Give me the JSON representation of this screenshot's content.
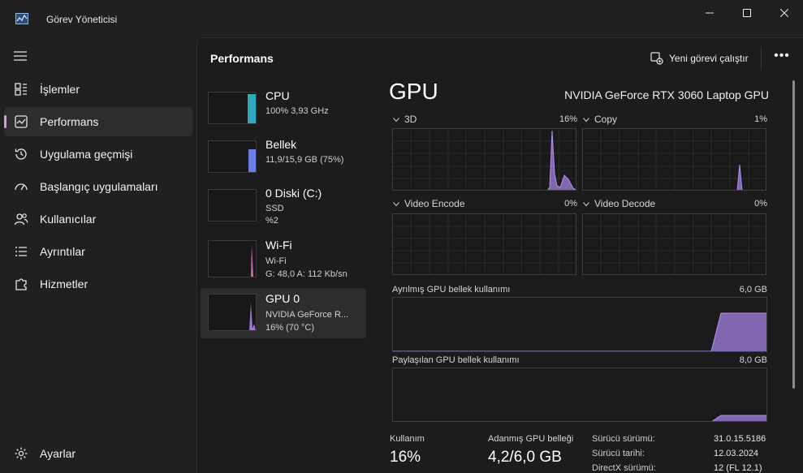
{
  "window": {
    "title": "Görev Yöneticisi"
  },
  "sidebar": {
    "items": [
      {
        "label": "İşlemler",
        "icon": "processes-grid-icon"
      },
      {
        "label": "Performans",
        "icon": "performance-chart-icon"
      },
      {
        "label": "Uygulama geçmişi",
        "icon": "history-clock-icon"
      },
      {
        "label": "Başlangıç uygulamaları",
        "icon": "startup-speedometer-icon"
      },
      {
        "label": "Kullanıcılar",
        "icon": "users-icon"
      },
      {
        "label": "Ayrıntılar",
        "icon": "details-list-icon"
      },
      {
        "label": "Hizmetler",
        "icon": "services-puzzle-icon"
      }
    ],
    "settings_label": "Ayarlar"
  },
  "header": {
    "title": "Performans",
    "run_task_label": "Yeni görevi çalıştır",
    "more_label": "•••"
  },
  "resources": [
    {
      "name": "CPU",
      "sub1": "100%  3,93 GHz",
      "sub2": "",
      "color": "#2fa9c0"
    },
    {
      "name": "Bellek",
      "sub1": "11,9/15,9 GB (75%)",
      "sub2": "",
      "color": "#6b7fe6"
    },
    {
      "name": "0 Diski (C:)",
      "sub1": "SSD",
      "sub2": "%2",
      "color": "#3ca37a"
    },
    {
      "name": "Wi-Fi",
      "sub1": "Wi-Fi",
      "sub2": "G: 48,0  A: 112 Kb/sn",
      "color": "#d46ab5"
    },
    {
      "name": "GPU 0",
      "sub1": "NVIDIA GeForce R...",
      "sub2": "16%  (70 °C)",
      "color": "#9b7ad6"
    }
  ],
  "gpu": {
    "title": "GPU",
    "model": "NVIDIA GeForce RTX 3060 Laptop GPU",
    "engines": [
      {
        "label": "3D",
        "value": "16%"
      },
      {
        "label": "Copy",
        "value": "1%"
      },
      {
        "label": "Video Encode",
        "value": "0%"
      },
      {
        "label": "Video Decode",
        "value": "0%"
      }
    ],
    "dedicated": {
      "label": "Ayrılmış GPU bellek kullanımı",
      "value": "6,0 GB"
    },
    "shared": {
      "label": "Paylaşılan GPU bellek kullanımı",
      "value": "8,0 GB"
    },
    "stats": {
      "usage_label": "Kullanım",
      "usage_value": "16%",
      "dedicated_label": "Adanmış GPU belleği",
      "dedicated_value": "4,2/6,0 GB"
    },
    "info": [
      {
        "label": "Sürücü sürümü:",
        "value": "31.0.15.5186"
      },
      {
        "label": "Sürücü tarihi:",
        "value": "12.03.2024"
      },
      {
        "label": "DirectX sürümü:",
        "value": "12 (FL 12.1)"
      }
    ],
    "accent": "#9b7ad6"
  }
}
